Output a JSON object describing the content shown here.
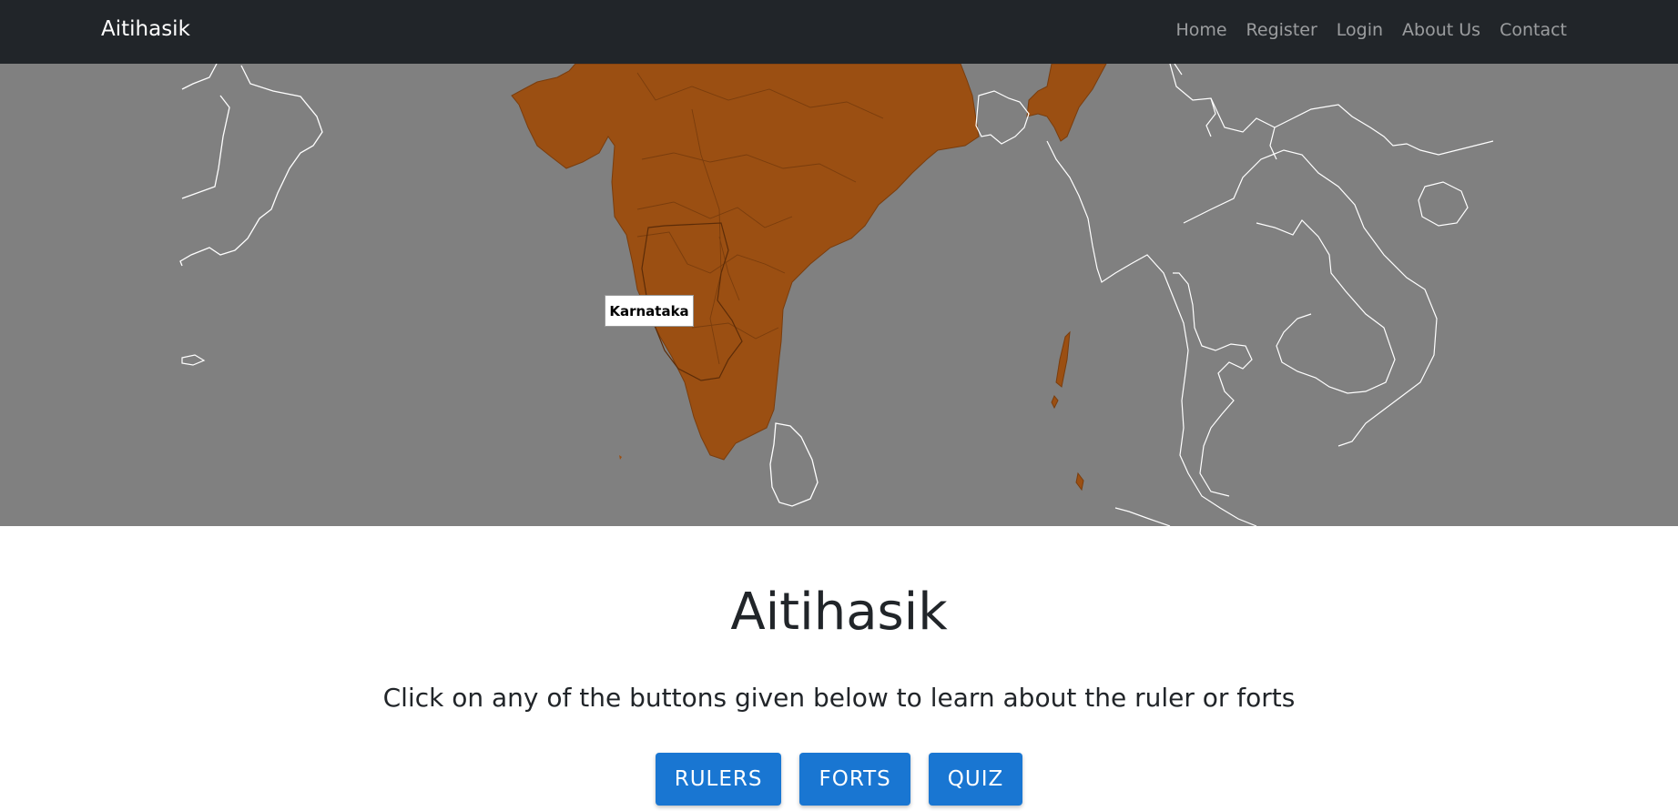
{
  "navbar": {
    "brand": "Aitihasik",
    "links": [
      "Home",
      "Register",
      "Login",
      "About Us",
      "Contact"
    ]
  },
  "map": {
    "tooltip": "Karnataka",
    "colors": {
      "ocean": "#808080",
      "highlight": "#9b4f12",
      "border": "#ffffff"
    }
  },
  "main": {
    "title": "Aitihasik",
    "subtitle": "Click on any of the buttons given below to learn about the ruler or forts",
    "buttons": [
      "RULERS",
      "FORTS",
      "QUIZ"
    ]
  },
  "colors": {
    "navbar": "#212529",
    "button": "#1976d2"
  }
}
